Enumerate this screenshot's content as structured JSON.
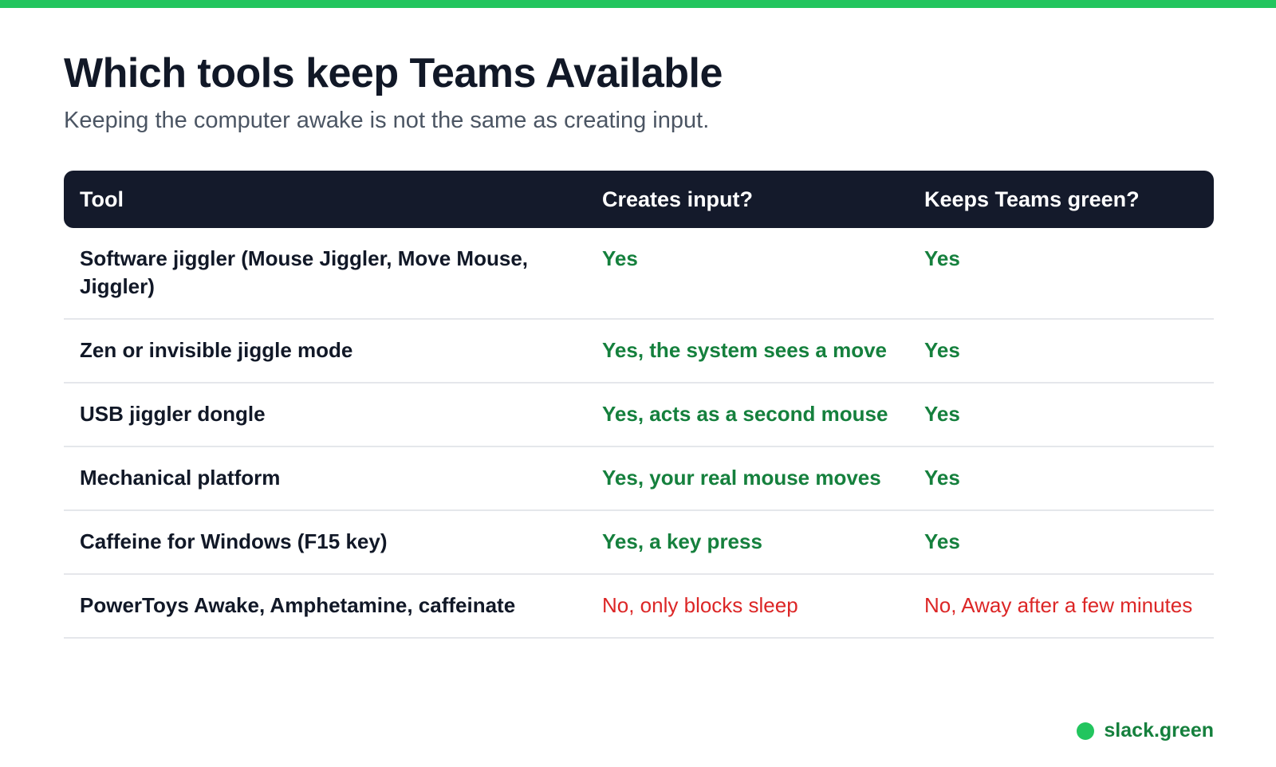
{
  "colors": {
    "accent": "#22c55e",
    "header_bg": "#141a2b",
    "yes_text": "#15803d",
    "no_text": "#dc2626"
  },
  "title": "Which tools keep Teams Available",
  "subtitle": "Keeping the computer awake is not the same as creating input.",
  "table": {
    "headers": [
      "Tool",
      "Creates input?",
      "Keeps Teams green?"
    ],
    "rows": [
      {
        "tool": "Software jiggler (Mouse Jiggler, Move Mouse, Jiggler)",
        "creates_input": "Yes",
        "keeps_green": "Yes",
        "positive": true
      },
      {
        "tool": "Zen or invisible jiggle mode",
        "creates_input": "Yes, the system sees a move",
        "keeps_green": "Yes",
        "positive": true
      },
      {
        "tool": "USB jiggler dongle",
        "creates_input": "Yes, acts as a second mouse",
        "keeps_green": "Yes",
        "positive": true
      },
      {
        "tool": "Mechanical platform",
        "creates_input": "Yes, your real mouse moves",
        "keeps_green": "Yes",
        "positive": true
      },
      {
        "tool": "Caffeine for Windows (F15 key)",
        "creates_input": "Yes, a key press",
        "keeps_green": "Yes",
        "positive": true
      },
      {
        "tool": "PowerToys Awake, Amphetamine, caffeinate",
        "creates_input": "No, only blocks sleep",
        "keeps_green": "No, Away after a few minutes",
        "positive": false
      }
    ]
  },
  "brand": {
    "icon": "green-dot-icon",
    "label": "slack.green"
  }
}
